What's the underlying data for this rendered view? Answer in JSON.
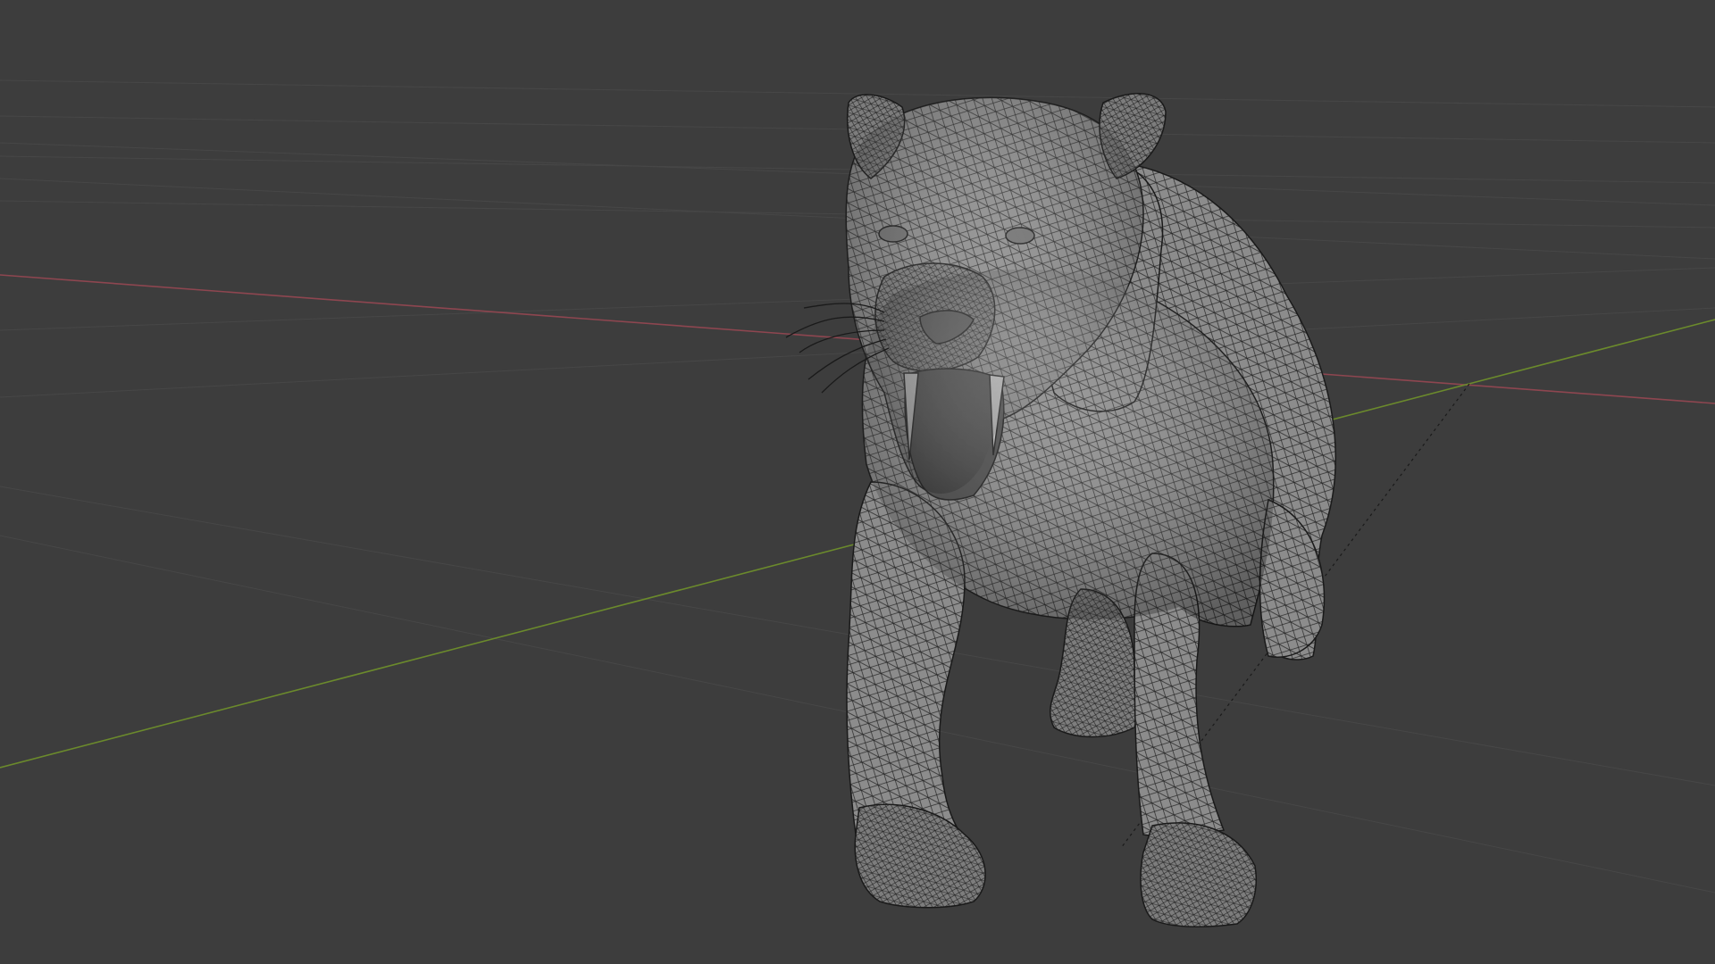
{
  "viewport": {
    "background": "#3d3d3d",
    "grid_color": "#474747",
    "x_axis_color": "#8e4650",
    "y_axis_color": "#6b8a2c",
    "object": "sabre-tooth-cat-mesh",
    "shading": "wireframe-overlay",
    "mesh_fill": "#8c8c8c",
    "mesh_wire": "#1e1e1e"
  }
}
